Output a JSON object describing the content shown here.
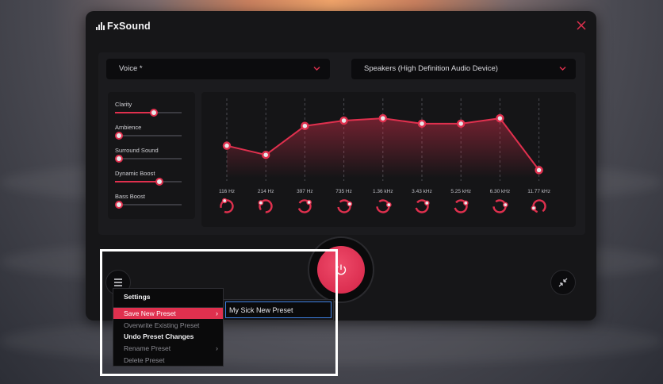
{
  "app": {
    "title": "FxSound"
  },
  "colors": {
    "accent": "#e0304e",
    "window_bg": "#161618",
    "panel_bg": "#1b1b1e"
  },
  "preset_select": {
    "value": "Voice *"
  },
  "device_select": {
    "value": "Speakers (High Definition Audio Device)"
  },
  "effects": [
    {
      "label": "Clarity",
      "level": 0.58
    },
    {
      "label": "Ambience",
      "level": 0.0
    },
    {
      "label": "Surround Sound",
      "level": 0.0
    },
    {
      "label": "Dynamic Boost",
      "level": 0.67
    },
    {
      "label": "Bass Boost",
      "level": 0.0
    }
  ],
  "equalizer": {
    "bands": [
      {
        "freq": "116 Hz",
        "level": 0.42
      },
      {
        "freq": "214 Hz",
        "level": 0.3
      },
      {
        "freq": "397 Hz",
        "level": 0.68
      },
      {
        "freq": "735 Hz",
        "level": 0.75
      },
      {
        "freq": "1.36 kHz",
        "level": 0.78
      },
      {
        "freq": "3.43 kHz",
        "level": 0.71
      },
      {
        "freq": "5.25 kHz",
        "level": 0.71
      },
      {
        "freq": "6.30 kHz",
        "level": 0.78
      },
      {
        "freq": "11.77 kHz",
        "level": 0.1
      }
    ]
  },
  "menu": {
    "items": [
      {
        "label": "Settings",
        "style": "header"
      },
      {
        "label": "Save New Preset",
        "style": "active",
        "submenu": true
      },
      {
        "label": "Overwrite Existing Preset",
        "style": "disabled"
      },
      {
        "label": "Undo Preset Changes",
        "style": "bold"
      },
      {
        "label": "Rename Preset",
        "style": "disabled",
        "submenu": true
      },
      {
        "label": "Delete Preset",
        "style": "disabled"
      }
    ]
  },
  "new_preset_input": {
    "value": "My Sick New Preset"
  },
  "icons": {
    "menu": "hamburger-icon",
    "close": "close-icon",
    "power": "power-icon",
    "shrink": "shrink-icon",
    "chevron": "chevron-down-icon"
  }
}
